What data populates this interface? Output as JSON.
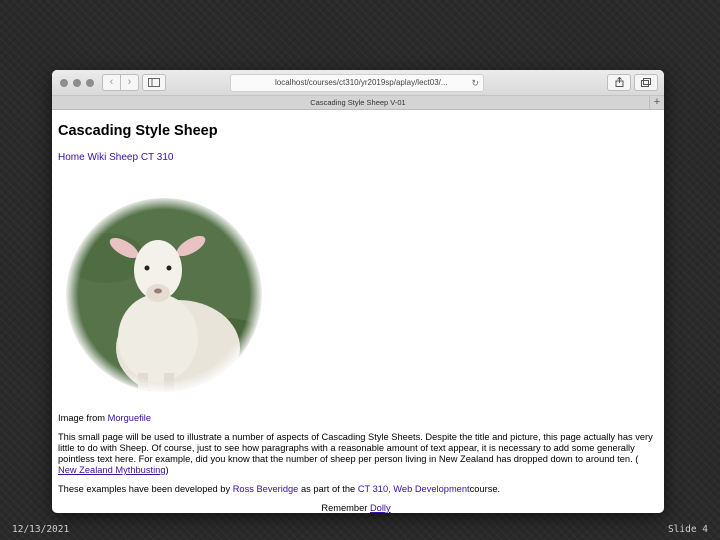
{
  "browser": {
    "url": "localhost/courses/ct310/yr2019sp/aplay/lect03/...",
    "tab_title": "Cascading Style Sheep V-01",
    "back_icon": "‹",
    "forward_icon": "›",
    "new_tab_icon": "+"
  },
  "page": {
    "title": "Cascading Style Sheep",
    "nav": [
      "Home",
      "Wiki Sheep",
      "CT 310"
    ],
    "image_credit_prefix": "Image from",
    "image_credit_link": "Morguefile",
    "paragraph1": "This small page will be used to illustrate a number of aspects of Cascading Style Sheets. Despite the title and picture, this page actually has very little to do with Sheep. Of course, just to see how paragraphs with a reasonable amount of text appear, it is necessary to add some generally pointless text here. For example, did you know that the number of sheep per person living in New Zealand has dropped down to around ten. (",
    "paragraph1_link": " New Zealand Mythbusting",
    "paragraph1_end": ")",
    "paragraph2_prefix": "These examples have been developed by",
    "paragraph2_author": "Ross Beveridge",
    "paragraph2_middle": "as part of the",
    "paragraph2_course": "CT 310, Web Development",
    "paragraph2_end": "course.",
    "remember_prefix": "Remember",
    "remember_link": "Dolly"
  },
  "slide": {
    "date": "12/13/2021",
    "number": "Slide 4"
  }
}
